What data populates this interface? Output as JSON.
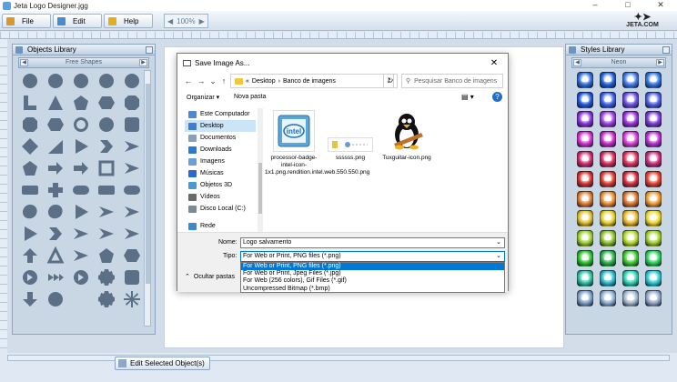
{
  "window": {
    "title": "Jeta Logo Designer.jgg",
    "controls": [
      "–",
      "□",
      "✕"
    ]
  },
  "menu": {
    "items": [
      {
        "label": "File",
        "color": "#d79a2a"
      },
      {
        "label": "Edit",
        "color": "#4a8bd0"
      },
      {
        "label": "Help",
        "color": "#e0b020"
      }
    ]
  },
  "zoom": {
    "value": "100%"
  },
  "logo": {
    "text": "JETA.COM"
  },
  "objects_library": {
    "title": "Objects Library",
    "category": "Free Shapes",
    "shapes": [
      "circle",
      "circle",
      "circle",
      "circle",
      "circle",
      "lshape",
      "triangle",
      "pentagon",
      "hexagon",
      "octagon",
      "octagon",
      "hexagon",
      "ring",
      "circle",
      "roundsquare",
      "diamond",
      "wedge",
      "play",
      "chevron",
      "arrowhead",
      "pentagon",
      "arrow",
      "arrow",
      "framesquare",
      "arrowhead",
      "roundrect",
      "plus",
      "pill",
      "roundrect",
      "pill",
      "blob",
      "blob",
      "play",
      "arrowhead",
      "arrowhead",
      "play",
      "chevron",
      "arrowhead",
      "arrowhead",
      "arrowhead",
      "arrowup",
      "ringtriangle",
      "arrowhead",
      "pentagon",
      "hexagon",
      "circlearrow",
      "arrowstrip",
      "circlearrow",
      "gear",
      "roundsquare",
      "arrowdown",
      "circle",
      "crescent",
      "gear",
      "asterisk"
    ]
  },
  "styles_library": {
    "title": "Styles Library",
    "category": "Neon",
    "colors": [
      "#2d6cd8",
      "#1f5fd3",
      "#3f79e6",
      "#2d74e0",
      "#2056d8",
      "#3a5fe6",
      "#6b4ee0",
      "#4b5fe2",
      "#8a2fe0",
      "#a23de4",
      "#9c2fd9",
      "#7d3ad6",
      "#d02fd3",
      "#c92ac9",
      "#d93ad8",
      "#b52fd1",
      "#d42a6a",
      "#d82a5a",
      "#e0305c",
      "#cc2a7a",
      "#d9302a",
      "#e03a2a",
      "#d52a3a",
      "#e8402a",
      "#e07a2a",
      "#e88a2a",
      "#d9742a",
      "#ee9a2a",
      "#e0c02a",
      "#e6d02a",
      "#e8b82a",
      "#f0d82a",
      "#9ad02a",
      "#8ac02a",
      "#b0d82a",
      "#a0d02a",
      "#2ac02a",
      "#2ab04a",
      "#3ac82a",
      "#2ad05a",
      "#2ac0a0",
      "#2ab8c8",
      "#2ad0b0",
      "#2ac8d0",
      "#7aa0c8",
      "#8ab0d0",
      "#a0b8d0",
      "#90a8c8"
    ]
  },
  "edit_button": {
    "label": "Edit Selected Object(s)"
  },
  "dialog": {
    "title": "Save Image As...",
    "path": [
      "Desktop",
      "Banco de imagens"
    ],
    "search_placeholder": "Pesquisar Banco de imagens",
    "organize": "Organizar ▾",
    "new_folder": "Nova pasta",
    "nav": [
      {
        "label": "Este Computador",
        "color": "#4a8bd0"
      },
      {
        "label": "Desktop",
        "color": "#3a7fd0",
        "selected": true
      },
      {
        "label": "Documentos",
        "color": "#8aa0b8"
      },
      {
        "label": "Downloads",
        "color": "#2a7ad0"
      },
      {
        "label": "Imagens",
        "color": "#6aa0d0"
      },
      {
        "label": "Músicas",
        "color": "#2a6ad0"
      },
      {
        "label": "Objetos 3D",
        "color": "#4a9ad0"
      },
      {
        "label": "Vídeos",
        "color": "#6a6a6a"
      },
      {
        "label": "Disco Local (C:)",
        "color": "#7a8a9a"
      },
      {
        "label": "Rede",
        "color": "#3a8ad0"
      }
    ],
    "files": [
      {
        "name": "processor-badge-intel-icon-1x1.png.rendition.intel.web.550.550.png"
      },
      {
        "name": "ssssss.png"
      },
      {
        "name": "Tuxguitar-icon.png"
      }
    ],
    "filename_label": "Nome:",
    "filename_value": "Logo salvamento",
    "type_label": "Tipo:",
    "type_value": "For Web or Print, PNG files (*.png)",
    "type_options": [
      "For Web or Print, PNG files (*.png)",
      "For Web or Print, Jpeg Files (*.jpg)",
      "For Web (256 colors), Gif Files (*.gif)",
      "Uncompressed Bitmap (*.bmp)"
    ],
    "hide_folders": "Ocultar pastas"
  }
}
